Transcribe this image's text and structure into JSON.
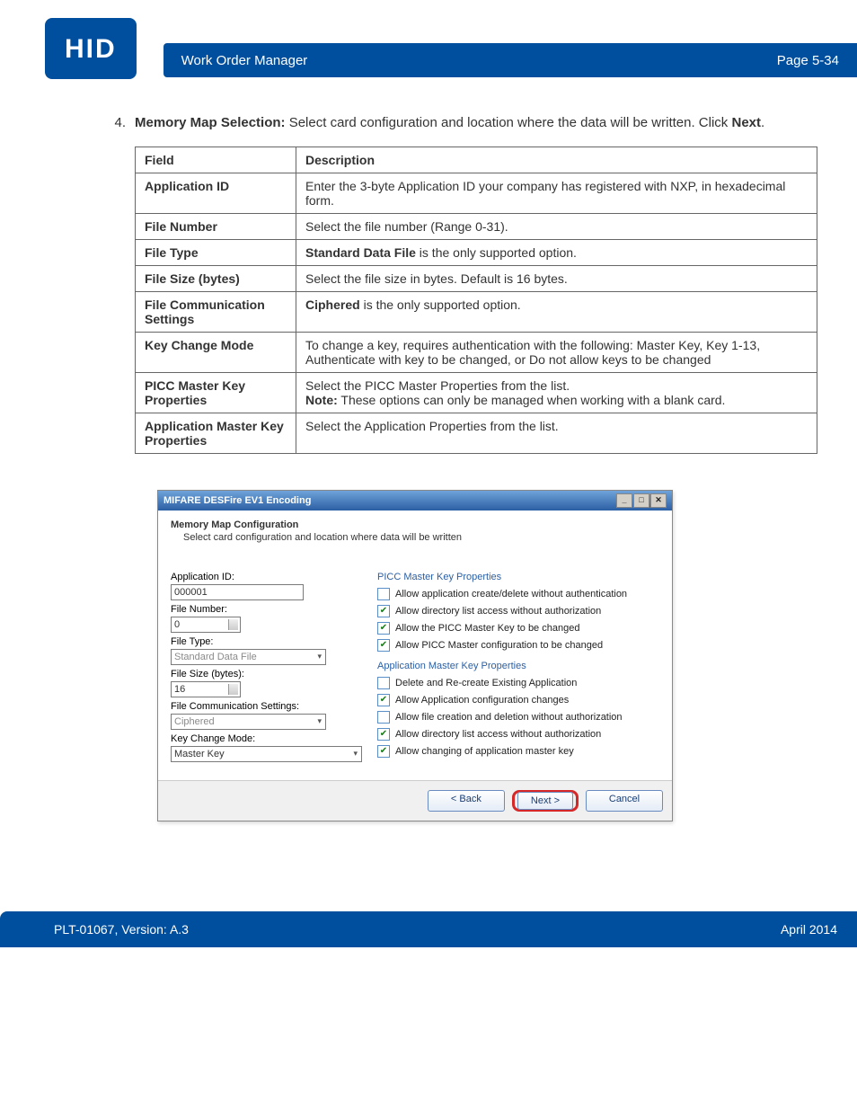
{
  "header": {
    "logo": "HID",
    "title": "Work Order Manager",
    "page": "Page 5-34"
  },
  "step": {
    "number": "4.",
    "heading": "Memory Map Selection:",
    "text_a": " Select card configuration and location where the data will be written. Click ",
    "bold_next": "Next",
    "text_b": "."
  },
  "table": {
    "head_field": "Field",
    "head_desc": "Description",
    "rows": [
      {
        "field": "Application ID",
        "desc_plain": "Enter the 3-byte Application ID your company has registered with NXP, in hexadecimal form."
      },
      {
        "field": "File Number",
        "desc_plain": "Select the file number (Range 0-31)."
      },
      {
        "field": "File Type",
        "desc_bold": "Standard Data File",
        "desc_tail": " is the only supported option."
      },
      {
        "field": "File Size (bytes)",
        "desc_plain": "Select the file size in bytes. Default is 16 bytes."
      },
      {
        "field": "File Communication Settings",
        "desc_bold": "Ciphered",
        "desc_tail": " is the only supported option."
      },
      {
        "field": "Key Change Mode",
        "desc_plain": "To change a key, requires authentication with the following: Master Key, Key 1-13, Authenticate with key to be changed, or Do not allow keys to be changed"
      },
      {
        "field": "PICC Master Key Properties",
        "desc_line1": "Select the PICC Master Properties from the list.",
        "desc_note_bold": "Note:",
        "desc_note_tail": " These options can only be managed when working with a blank card."
      },
      {
        "field": "Application Master Key Properties",
        "desc_plain": "Select the Application Properties from the list."
      }
    ]
  },
  "dialog": {
    "title": "MIFARE DESFire EV1 Encoding",
    "sub_bold": "Memory Map  Configuration",
    "sub_line": "Select card configuration and location where data will be written",
    "left": {
      "app_id_lbl": "Application ID:",
      "app_id_val": "000001",
      "file_num_lbl": "File Number:",
      "file_num_val": "0",
      "file_type_lbl": "File Type:",
      "file_type_val": "Standard Data File",
      "file_size_lbl": "File Size (bytes):",
      "file_size_val": "16",
      "comm_lbl": "File Communication Settings:",
      "comm_val": "Ciphered",
      "key_mode_lbl": "Key Change Mode:",
      "key_mode_val": "Master Key"
    },
    "right": {
      "sec1": "PICC Master Key Properties",
      "c1": {
        "checked": false,
        "label": "Allow application create/delete without authentication"
      },
      "c2": {
        "checked": true,
        "label": "Allow directory list access without authorization"
      },
      "c3": {
        "checked": true,
        "label": "Allow the PICC Master Key to be changed"
      },
      "c4": {
        "checked": true,
        "label": "Allow PICC Master configuration to be changed"
      },
      "sec2": "Application Master Key Properties",
      "c5": {
        "checked": false,
        "label": "Delete and Re-create Existing Application"
      },
      "c6": {
        "checked": true,
        "label": "Allow Application configuration changes"
      },
      "c7": {
        "checked": false,
        "label": "Allow file creation and deletion without authorization"
      },
      "c8": {
        "checked": true,
        "label": "Allow directory list access without authorization"
      },
      "c9": {
        "checked": true,
        "label": "Allow changing of application master key"
      }
    },
    "buttons": {
      "back": "< Back",
      "next": "Next >",
      "cancel": "Cancel"
    }
  },
  "footer": {
    "left": "PLT-01067, Version: A.3",
    "right": "April 2014"
  }
}
